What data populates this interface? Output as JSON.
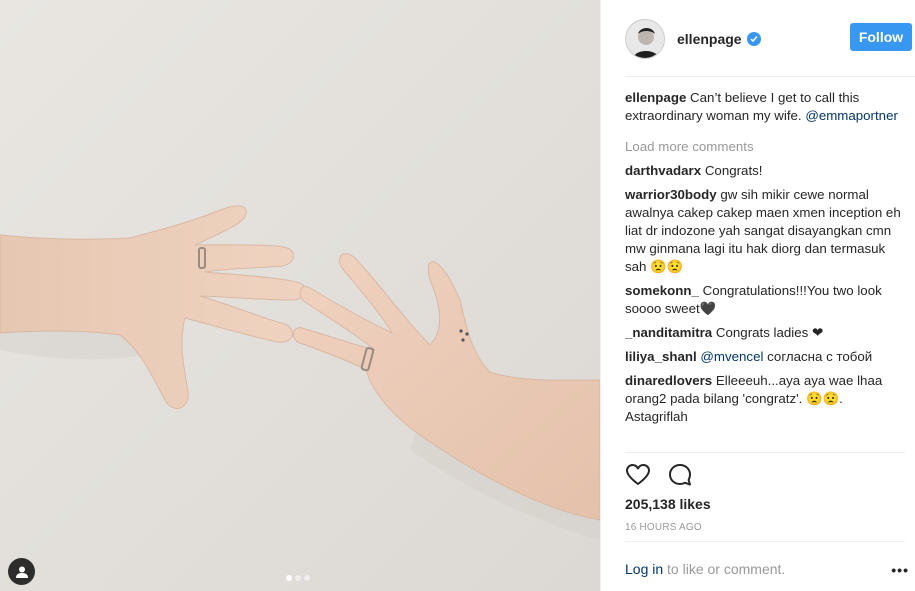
{
  "post": {
    "username": "ellenpage",
    "follow_label": "Follow",
    "caption_user": "ellenpage",
    "caption_text": "Can’t believe I get to call this extraordinary woman my wife.",
    "caption_mention": "@emmaportner",
    "load_more": "Load more comments",
    "likes": "205,138 likes",
    "timestamp": "16 HOURS AGO",
    "login_link": "Log in",
    "login_rest": "to like or comment.",
    "more_icon": "•••",
    "carousel_dots": 3,
    "active_dot": 0
  },
  "comments": [
    {
      "user": "darthvadarx",
      "text": "Congrats!"
    },
    {
      "user": "warrior30body",
      "text": "gw sih mikir cewe normal awalnya cakep cakep maen xmen inception eh liat dr indozone yah sangat disayangkan cmn mw ginmana lagi itu hak diorg dan termasuk sah 😟😟"
    },
    {
      "user": "somekonn_",
      "text": "Congratulations!!!You two look soooo sweet🖤"
    },
    {
      "user": "_nanditamitra",
      "text": "Congrats ladies ❤"
    },
    {
      "user": "liliya_shanl",
      "mention": "@mvencel",
      "text": "согласна с тобой"
    },
    {
      "user": "dinaredlovers",
      "text": "Elleeeuh...aya aya wae lhaa orang2 pada bilang 'congratz'. 😟😟. Astagriflah"
    }
  ],
  "colors": {
    "accent": "#3897f0",
    "link": "#003569",
    "muted": "#999999"
  },
  "icons": {
    "tag": "person-tag-icon",
    "verified": "verified-badge-icon",
    "like": "heart-icon",
    "comment": "comment-bubble-icon",
    "more": "more-options-icon"
  }
}
